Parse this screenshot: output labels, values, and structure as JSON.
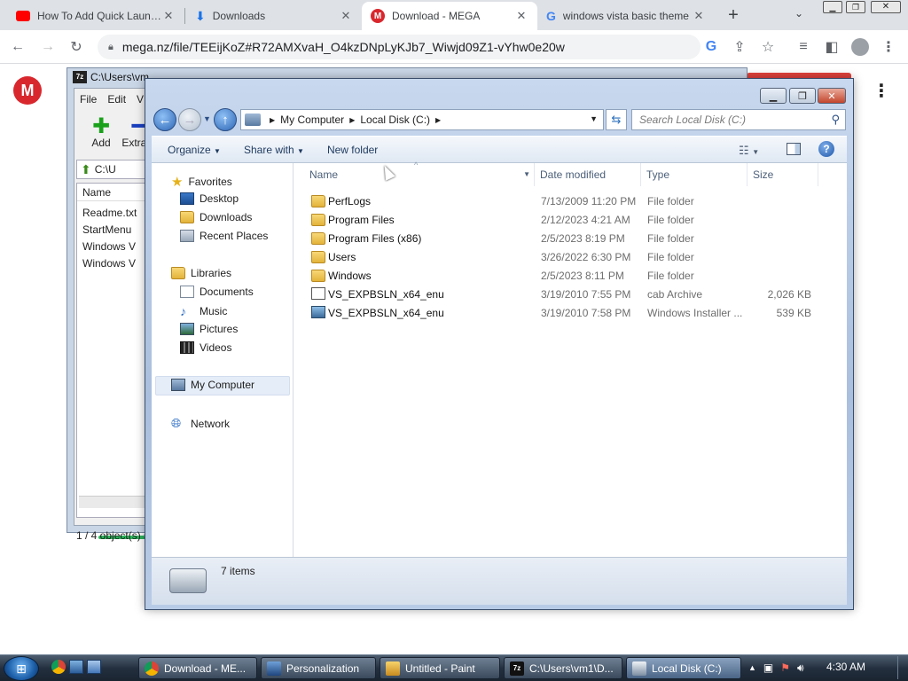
{
  "browser": {
    "tabs": [
      {
        "title": "How To Add Quick Launch T",
        "icon": "youtube-icon",
        "active": false
      },
      {
        "title": "Downloads",
        "icon": "download-icon",
        "active": false
      },
      {
        "title": "Download - MEGA",
        "icon": "mega-icon",
        "active": true
      },
      {
        "title": "windows vista basic theme",
        "icon": "google-icon",
        "active": false
      }
    ],
    "url": "mega.nz/file/TEEijKoZ#R72AMXvaH_O4kzDNpLyKJb7_Wiwjd09Z1-vYhw0e20w"
  },
  "mega": {
    "logo_letter": "M",
    "accent": "#d9272e"
  },
  "sevenzip": {
    "title": "C:\\Users\\vm",
    "menu": [
      "File",
      "Edit",
      "V"
    ],
    "toolbar": [
      "Add",
      "Extract"
    ],
    "path": "C:\\U",
    "column": "Name",
    "files": [
      "Readme.txt",
      "StartMenu",
      "Windows V",
      "Windows V"
    ],
    "status": "1 / 4 object(s) s"
  },
  "explorer": {
    "breadcrumb": [
      "My Computer",
      "Local Disk (C:)"
    ],
    "search_placeholder": "Search Local Disk (C:)",
    "commands": {
      "organize": "Organize",
      "share": "Share with",
      "new_folder": "New folder"
    },
    "nav": {
      "favorites": {
        "label": "Favorites",
        "items": [
          "Desktop",
          "Downloads",
          "Recent Places"
        ]
      },
      "libraries": {
        "label": "Libraries",
        "items": [
          "Documents",
          "Music",
          "Pictures",
          "Videos"
        ]
      },
      "computer": "My Computer",
      "network": "Network"
    },
    "columns": [
      "Name",
      "Date modified",
      "Type",
      "Size"
    ],
    "files": [
      {
        "name": "PerfLogs",
        "date": "7/13/2009 11:20 PM",
        "type": "File folder",
        "size": "",
        "icon": "folder-icon"
      },
      {
        "name": "Program Files",
        "date": "2/12/2023 4:21 AM",
        "type": "File folder",
        "size": "",
        "icon": "folder-icon"
      },
      {
        "name": "Program Files (x86)",
        "date": "2/5/2023 8:19 PM",
        "type": "File folder",
        "size": "",
        "icon": "folder-icon"
      },
      {
        "name": "Users",
        "date": "3/26/2022 6:30 PM",
        "type": "File folder",
        "size": "",
        "icon": "folder-icon"
      },
      {
        "name": "Windows",
        "date": "2/5/2023 8:11 PM",
        "type": "File folder",
        "size": "",
        "icon": "folder-icon"
      },
      {
        "name": "VS_EXPBSLN_x64_enu",
        "date": "3/19/2010 7:55 PM",
        "type": "cab Archive",
        "size": "2,026 KB",
        "icon": "cab-icon"
      },
      {
        "name": "VS_EXPBSLN_x64_enu",
        "date": "3/19/2010 7:58 PM",
        "type": "Windows Installer ...",
        "size": "539 KB",
        "icon": "installer-icon"
      }
    ],
    "item_count": "7 items"
  },
  "taskbar": {
    "buttons": [
      {
        "label": "Download - ME...",
        "icon": "chrome-icon",
        "active": false
      },
      {
        "label": "Personalization",
        "icon": "personalization-icon",
        "active": false
      },
      {
        "label": "Untitled - Paint",
        "icon": "paint-icon",
        "active": false
      },
      {
        "label": "C:\\Users\\vm1\\D...",
        "icon": "7zip-icon",
        "active": false
      },
      {
        "label": "Local Disk (C:)",
        "icon": "explorer-icon",
        "active": true
      }
    ],
    "clock": "4:30 AM"
  }
}
